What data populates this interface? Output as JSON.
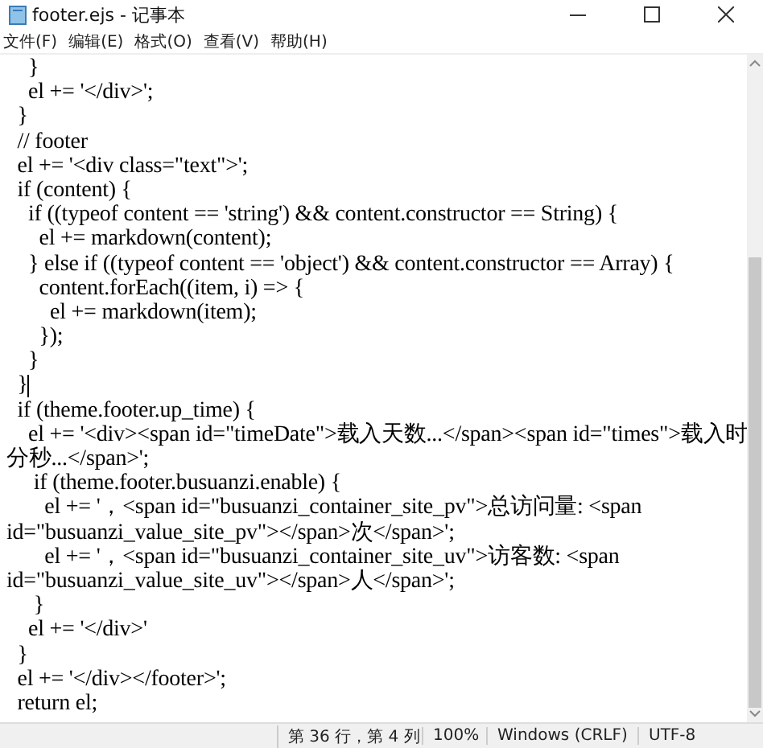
{
  "window": {
    "title": "footer.ejs - 记事本"
  },
  "menu": [
    "文件(F)",
    "编辑(E)",
    "格式(O)",
    "查看(V)",
    "帮助(H)"
  ],
  "lines": [
    {
      "text": "    }",
      "caret": false
    },
    {
      "text": "    el += '</div>';",
      "caret": false
    },
    {
      "text": "  }",
      "caret": false
    },
    {
      "text": "  // footer",
      "caret": false
    },
    {
      "text": "  el += '<div class=\"text\">';",
      "caret": false
    },
    {
      "text": "  if (content) {",
      "caret": false
    },
    {
      "text": "    if ((typeof content == 'string') && content.constructor == String) {",
      "caret": false
    },
    {
      "text": "      el += markdown(content);",
      "caret": false
    },
    {
      "text": "    } else if ((typeof content == 'object') && content.constructor == Array) {",
      "caret": false
    },
    {
      "text": "      content.forEach((item, i) => {",
      "caret": false
    },
    {
      "text": "        el += markdown(item);",
      "caret": false
    },
    {
      "text": "      });",
      "caret": false
    },
    {
      "text": "    }",
      "caret": false
    },
    {
      "text": "  }",
      "caret": true
    },
    {
      "text": "  if (theme.footer.up_time) {",
      "caret": false
    },
    {
      "text": "    el += '<div><span id=\"timeDate\">载入天数...</span><span id=\"times\">载入时",
      "caret": false
    },
    {
      "text": "分秒...</span>';",
      "caret": false
    },
    {
      "text": "     if (theme.footer.busuanzi.enable) {",
      "caret": false
    },
    {
      "text": "       el += '，<span id=\"busuanzi_container_site_pv\">总访问量: <span",
      "caret": false
    },
    {
      "text": "id=\"busuanzi_value_site_pv\"></span>次</span>';",
      "caret": false
    },
    {
      "text": "       el += '，<span id=\"busuanzi_container_site_uv\">访客数: <span",
      "caret": false
    },
    {
      "text": "id=\"busuanzi_value_site_uv\"></span>人</span>';",
      "caret": false
    },
    {
      "text": "     }",
      "caret": false
    },
    {
      "text": "    el += '</div>'",
      "caret": false
    },
    {
      "text": "  }",
      "caret": false
    },
    {
      "text": "  el += '</div></footer>';",
      "caret": false
    },
    {
      "text": "  return el;",
      "caret": false
    }
  ],
  "status_bar": {
    "position": "第 36 行，第 4 列",
    "zoom": "100%",
    "line_ending": "Windows (CRLF)",
    "encoding": "UTF-8"
  }
}
